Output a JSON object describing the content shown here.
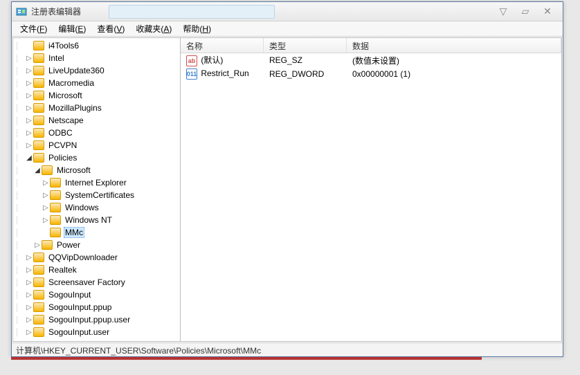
{
  "window": {
    "title": "注册表编辑器"
  },
  "winbuttons": {
    "min": "▽",
    "max": "▱",
    "close": "✕"
  },
  "menubar": [
    {
      "label": "文件",
      "accel": "F"
    },
    {
      "label": "编辑",
      "accel": "E"
    },
    {
      "label": "查看",
      "accel": "V"
    },
    {
      "label": "收藏夹",
      "accel": "A"
    },
    {
      "label": "帮助",
      "accel": "H"
    }
  ],
  "tree": {
    "root": [
      {
        "label": "i4Tools6",
        "expand": "leaf",
        "depth": 1
      },
      {
        "label": "Intel",
        "expand": "closed",
        "depth": 1
      },
      {
        "label": "LiveUpdate360",
        "expand": "closed",
        "depth": 1
      },
      {
        "label": "Macromedia",
        "expand": "closed",
        "depth": 1
      },
      {
        "label": "Microsoft",
        "expand": "closed",
        "depth": 1
      },
      {
        "label": "MozillaPlugins",
        "expand": "closed",
        "depth": 1
      },
      {
        "label": "Netscape",
        "expand": "closed",
        "depth": 1
      },
      {
        "label": "ODBC",
        "expand": "closed",
        "depth": 1
      },
      {
        "label": "PCVPN",
        "expand": "closed",
        "depth": 1
      },
      {
        "label": "Policies",
        "expand": "open",
        "depth": 1,
        "children": [
          {
            "label": "Microsoft",
            "expand": "open",
            "depth": 2,
            "children": [
              {
                "label": "Internet Explorer",
                "expand": "closed",
                "depth": 3
              },
              {
                "label": "SystemCertificates",
                "expand": "closed",
                "depth": 3
              },
              {
                "label": "Windows",
                "expand": "closed",
                "depth": 3
              },
              {
                "label": "Windows NT",
                "expand": "closed",
                "depth": 3
              },
              {
                "label": "MMc",
                "expand": "leaf",
                "depth": 3,
                "selected": true
              }
            ]
          },
          {
            "label": "Power",
            "expand": "closed",
            "depth": 2
          }
        ]
      },
      {
        "label": "QQVipDownloader",
        "expand": "closed",
        "depth": 1
      },
      {
        "label": "Realtek",
        "expand": "closed",
        "depth": 1
      },
      {
        "label": "Screensaver Factory",
        "expand": "closed",
        "depth": 1
      },
      {
        "label": "SogouInput",
        "expand": "closed",
        "depth": 1
      },
      {
        "label": "SogouInput.ppup",
        "expand": "closed",
        "depth": 1
      },
      {
        "label": "SogouInput.ppup.user",
        "expand": "closed",
        "depth": 1
      },
      {
        "label": "SogouInput.user",
        "expand": "closed",
        "depth": 1
      }
    ]
  },
  "list": {
    "headers": {
      "name": "名称",
      "type": "类型",
      "data": "数据"
    },
    "rows": [
      {
        "icon": "str",
        "name": "(默认)",
        "type": "REG_SZ",
        "data": "(数值未设置)"
      },
      {
        "icon": "dw",
        "name": "Restrict_Run",
        "type": "REG_DWORD",
        "data": "0x00000001 (1)"
      }
    ]
  },
  "statusbar": {
    "path": "计算机\\HKEY_CURRENT_USER\\Software\\Policies\\Microsoft\\MMc"
  }
}
